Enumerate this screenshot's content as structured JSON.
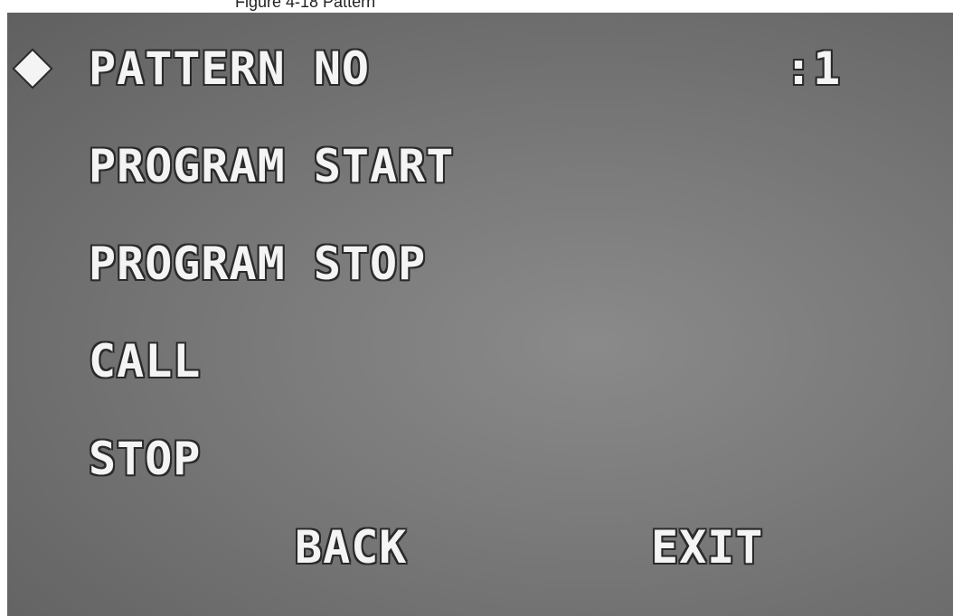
{
  "caption": "Figure 4-18 Pattern",
  "cursor_icon": "diamond-cursor-icon",
  "menu": {
    "items": [
      {
        "label": "PATTERN NO",
        "value": ":1"
      },
      {
        "label": "PROGRAM START"
      },
      {
        "label": "PROGRAM STOP"
      },
      {
        "label": "CALL"
      },
      {
        "label": "STOP"
      }
    ],
    "back_label": "BACK",
    "exit_label": "EXIT",
    "selected_index": 0
  },
  "colors": {
    "text": "#f4f4f4",
    "outline": "#2a2a2a",
    "background": "#7c7c7c"
  }
}
